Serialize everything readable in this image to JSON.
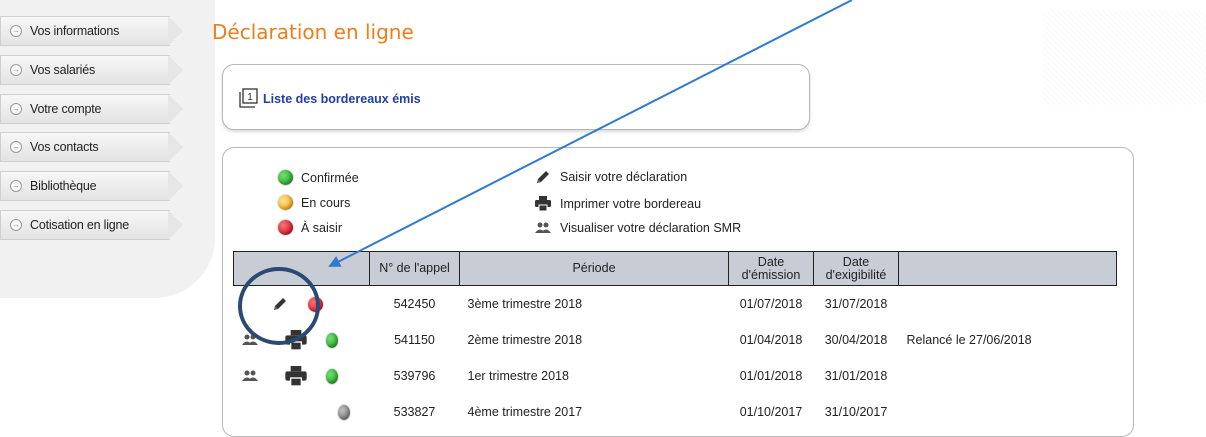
{
  "sidebar": {
    "items": [
      {
        "label": "Vos informations"
      },
      {
        "label": "Vos salariés"
      },
      {
        "label": "Votre compte"
      },
      {
        "label": "Vos contacts"
      },
      {
        "label": "Bibliothèque"
      },
      {
        "label": "Cotisation en ligne"
      }
    ]
  },
  "page": {
    "title": "Déclaration en ligne",
    "list_link": "Liste des bordereaux émis"
  },
  "legend": {
    "status": [
      {
        "label": "Confirmée",
        "color": "#1a9c1a"
      },
      {
        "label": "En cours",
        "color": "#f5a000"
      },
      {
        "label": "À saisir",
        "color": "#c4001b"
      }
    ],
    "actions": [
      {
        "label": "Saisir votre déclaration",
        "icon": "pencil-icon"
      },
      {
        "label": "Imprimer votre bordereau",
        "icon": "printer-icon"
      },
      {
        "label": "Visualiser votre déclaration SMR",
        "icon": "users-icon"
      }
    ]
  },
  "table": {
    "headers": {
      "num": "N° de l'appel",
      "periode": "Période",
      "emission_1": "Date",
      "emission_2": "d'émission",
      "exig_1": "Date",
      "exig_2": "d'exigibilité"
    },
    "rows": [
      {
        "num": "542450",
        "periode": "3ème trimestre 2018",
        "emission": "01/07/2018",
        "exigibilite": "31/07/2018",
        "note": "",
        "status": "red"
      },
      {
        "num": "541150",
        "periode": "2ème trimestre 2018",
        "emission": "01/04/2018",
        "exigibilite": "30/04/2018",
        "note": "Relancé le 27/06/2018",
        "status": "green"
      },
      {
        "num": "539796",
        "periode": "1er trimestre 2018",
        "emission": "01/01/2018",
        "exigibilite": "31/01/2018",
        "note": "",
        "status": "green"
      },
      {
        "num": "533827",
        "periode": "4ème trimestre 2017",
        "emission": "01/10/2017",
        "exigibilite": "31/10/2017",
        "note": "",
        "status": "grey"
      }
    ]
  },
  "annotation": {
    "color": "#2e7bcf",
    "circle_color": "#2b4a73"
  }
}
